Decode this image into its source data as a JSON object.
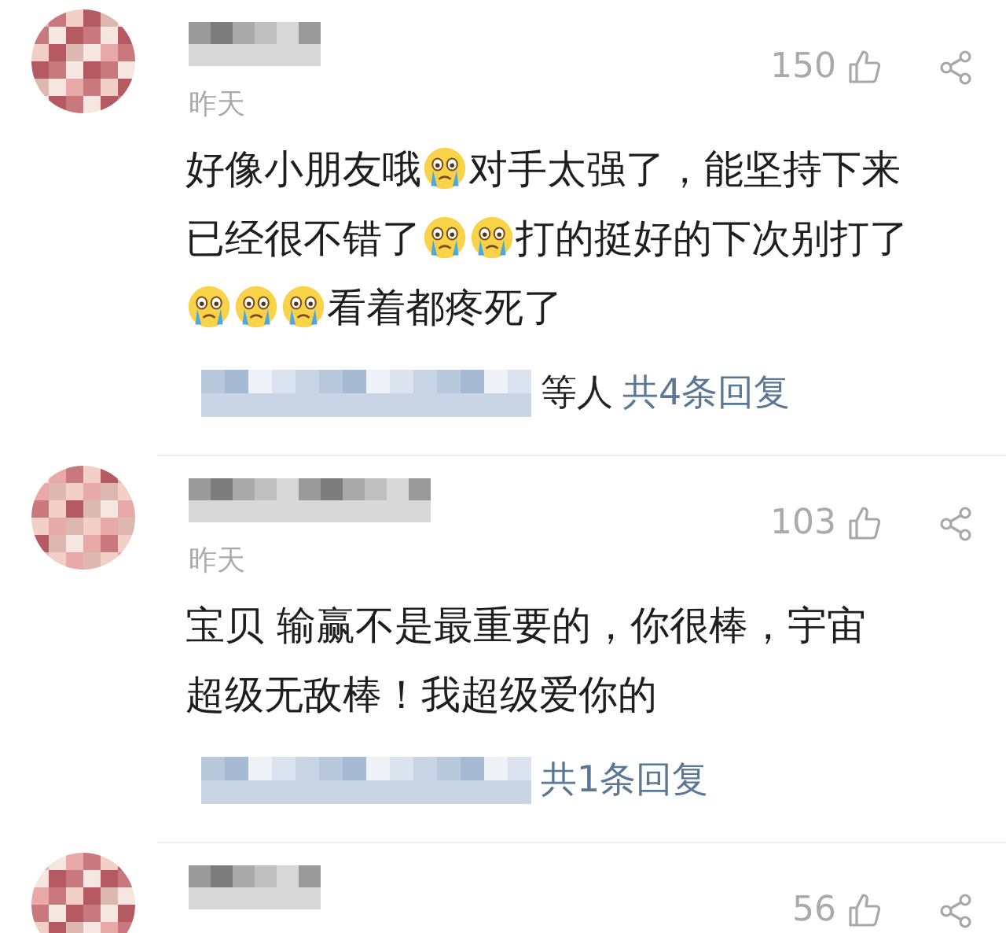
{
  "comments": [
    {
      "time": "昨天",
      "likes": "150",
      "body_lines": [
        [
          {
            "kind": "text",
            "text": "好像小朋友哦"
          },
          {
            "kind": "emoji"
          },
          {
            "kind": "text",
            "text": "对手太强了，能坚持下来"
          }
        ],
        [
          {
            "kind": "text",
            "text": "已经很不错了"
          },
          {
            "kind": "emoji"
          },
          {
            "kind": "emoji"
          },
          {
            "kind": "text",
            "text": "打的挺好的下次别打了"
          }
        ],
        [
          {
            "kind": "emoji"
          },
          {
            "kind": "emoji"
          },
          {
            "kind": "emoji"
          },
          {
            "kind": "text",
            "text": "看着都疼死了"
          }
        ]
      ],
      "replies": {
        "suffix": "等人",
        "link": "共4条回复"
      }
    },
    {
      "time": "昨天",
      "likes": "103",
      "body_lines": [
        [
          {
            "kind": "text",
            "text": "宝贝 输赢不是最重要的，你很棒，宇宙"
          }
        ],
        [
          {
            "kind": "text",
            "text": "超级无敌棒！我超级爱你的"
          }
        ]
      ],
      "replies": {
        "link": "共1条回复"
      }
    },
    {
      "likes": "56"
    }
  ]
}
